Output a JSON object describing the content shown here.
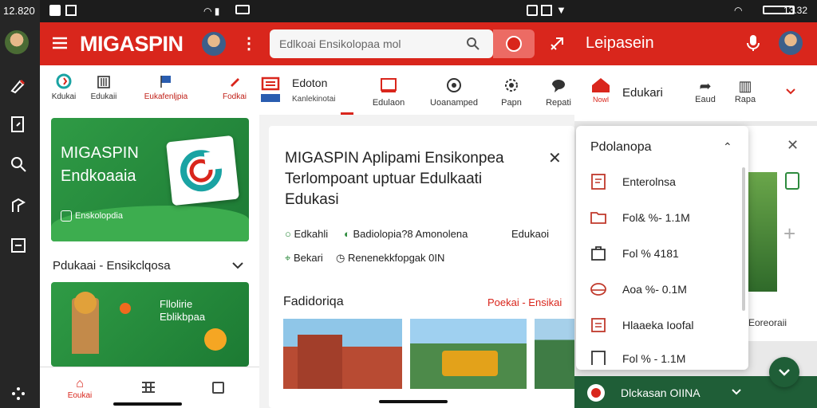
{
  "status_left": {
    "time": "12.820"
  },
  "status_right": {
    "time": "13.32"
  },
  "rail": {
    "icons": [
      "brush-icon",
      "document-icon",
      "search-icon",
      "settings-icon",
      "export-icon",
      "dots-icon"
    ]
  },
  "panel1": {
    "brand": "MIGASPIN",
    "categories": [
      {
        "label": "Kdukai",
        "icon": "logo-icon"
      },
      {
        "label": "Edukaii",
        "icon": "building-icon"
      },
      {
        "label": "Eukafenljpia",
        "icon": "flag-icon"
      },
      {
        "label": "Fodkai",
        "icon": "pencil-icon"
      }
    ],
    "hero": {
      "title_line1": "MIGASPIN",
      "title_line2": "Endkoaaia",
      "chip": "Enskolopdia"
    },
    "section_title": "Pdukaai - Ensikclqosa",
    "promo": {
      "line1": "Fllolirie",
      "line2": "Eblikbpaa"
    },
    "bottom_nav": [
      {
        "label": "Eoukai",
        "icon": "home-icon"
      },
      {
        "label": "",
        "icon": "grid-icon"
      },
      {
        "label": "",
        "icon": "square-icon"
      }
    ]
  },
  "panel2": {
    "search_placeholder": "Edlkoai Ensikolopaa mol",
    "tabs": [
      {
        "title": "Edoton",
        "subtitle": "Kanlekinotai"
      },
      {
        "label": "Edulaon"
      },
      {
        "label": "Uoanamped"
      },
      {
        "label": "Papn"
      },
      {
        "label": "Repati"
      }
    ],
    "card": {
      "title_line1": "MIGASPIN Aplipami Ensikonpea",
      "title_line2": "Terlompoant uptuar Edulkaati",
      "title_line3": "Edukasi",
      "meta": [
        "Edkahli",
        "Badiolopia?8 Amonolena",
        "Edukaoi",
        "Bekari",
        "Renenekkfopgak 0IN"
      ],
      "section_title": "Fadidoriqa",
      "section_link": "Poekai - Ensikai"
    }
  },
  "panel3": {
    "title": "Leipasein",
    "subbar_label": "Edukari",
    "subbar_actions": [
      {
        "label": "Eaud"
      },
      {
        "label": "Rapa"
      }
    ],
    "side_caption": "Eoreoraii",
    "bottom_label": "Dlckasan OIINA"
  },
  "dropdown": {
    "title": "Pdolanopa",
    "items": [
      {
        "label": "Enterolnsa"
      },
      {
        "label": "Fol& %- 1.1M"
      },
      {
        "label": "Fol % 4181"
      },
      {
        "label": "Aoa %- 0.1M"
      },
      {
        "label": "Hlaaeka Ioofal"
      },
      {
        "label": "Fol % - 1.1M"
      }
    ]
  },
  "colors": {
    "brand_red": "#d9261c",
    "green": "#2e8b3e",
    "dark": "#1c1c1c"
  }
}
